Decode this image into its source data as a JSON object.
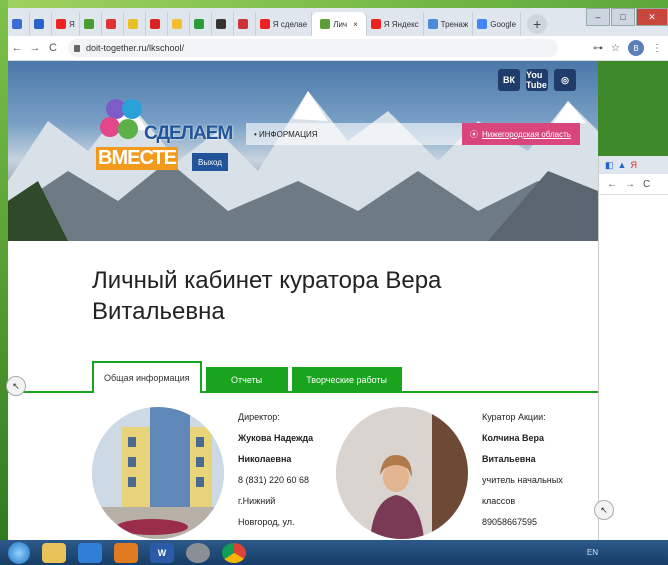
{
  "browser": {
    "tabs": [
      {
        "label": "",
        "color": "#3a6fd1"
      },
      {
        "label": "",
        "color": "#2a62c7"
      },
      {
        "label": "Я",
        "color": "#e22"
      },
      {
        "label": "",
        "color": "#4a9d2e"
      },
      {
        "label": "",
        "color": "#d33"
      },
      {
        "label": "",
        "color": "#e8c020"
      },
      {
        "label": "",
        "color": "#d22"
      },
      {
        "label": "",
        "color": "#f0c030"
      },
      {
        "label": "",
        "color": "#2a9d3a"
      },
      {
        "label": "",
        "color": "#333"
      },
      {
        "label": "",
        "color": "#cc3333"
      },
      {
        "label": "Я сделае",
        "color": "#e22"
      },
      {
        "label": "Лич",
        "color": "#5a9d3a",
        "active": true
      },
      {
        "label": "Я Яндекс",
        "color": "#e22"
      },
      {
        "label": "Тренаж",
        "color": "#4a8dd8"
      },
      {
        "label": "Google",
        "color": "#4285f4"
      }
    ],
    "close_glyph": "×",
    "new_tab_glyph": "+",
    "url": "doit-together.ru/lkschool/",
    "profile_letter": "В",
    "nav": {
      "back": "←",
      "forward": "→",
      "reload": "C"
    },
    "toolbar_icons": {
      "key": "⊶",
      "star": "☆",
      "menu": "⋮"
    },
    "window_controls": {
      "minimize": "‒",
      "maximize": "□",
      "close": "✕"
    }
  },
  "site": {
    "socials": [
      "ВК",
      "You Tube",
      "◎"
    ],
    "logo_line1": "СДЕЛАЕМ",
    "logo_line2": "ВМЕСТЕ",
    "exit_label": "Выход",
    "nav_item": "• ИНФОРМАЦИЯ",
    "region_label": "Нижегородская область",
    "heading": "Личный кабинет куратора Вера Витальевна",
    "tabs": [
      "Общая информация",
      "Отчеты",
      "Творческие работы"
    ],
    "director": {
      "role": "Директор:",
      "name_line1": "Жукова Надежда",
      "name_line2": "Николаевна",
      "phone": "8 (831) 220 60 68",
      "city_line1": "г.Нижний",
      "city_line2": "Новгород, ул."
    },
    "curator": {
      "role": "Куратор Акции:",
      "name_line1": "Колчина Вера",
      "name_line2": "Витальевна",
      "position_line1": "учитель начальных",
      "position_line2": "классов",
      "phone": "89058667595"
    }
  },
  "taskbar": {
    "word_label": "W",
    "lang": "EN"
  }
}
